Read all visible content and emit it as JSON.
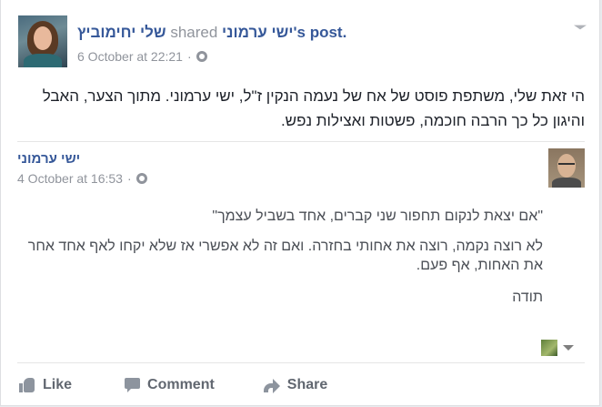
{
  "post": {
    "author": "שלי יחימוביץ",
    "shared_word": "shared",
    "source_author": "ישי ערמוני",
    "possessive": "'s",
    "post_word": "post.",
    "timestamp": "6 October at 22:21",
    "separator": "·",
    "text": "הי זאת שלי, משתפת פוסט של אח של נעמה הנקין ז\"ל, ישי ערמוני. מתוך הצער, האבל והיגון כל כך הרבה חוכמה, פשטות ואצילות נפש."
  },
  "shared_post": {
    "author": "ישי ערמוני",
    "timestamp": "4 October at 16:53",
    "separator": "·",
    "paragraph_1": "\"אם יצאת לנקום תחפור שני קברים, אחד בשביל עצמך\"",
    "paragraph_2": "לא רוצה נקמה, רוצה את אחותי בחזרה. ואם זה לא אפשרי אז שלא יקחו לאף אחד אחר את האחות, אף פעם.",
    "paragraph_3": "תודה"
  },
  "actions": {
    "like": "Like",
    "comment": "Comment",
    "share": "Share"
  },
  "icons": {
    "privacy": "globe-icon",
    "options": "chevron-down-icon",
    "like": "thumbs-up-icon",
    "comment": "speech-bubble-icon",
    "share": "share-arrow-icon"
  },
  "colors": {
    "link": "#365899",
    "text": "#1d2129",
    "muted": "#90949c",
    "action": "#616770"
  }
}
